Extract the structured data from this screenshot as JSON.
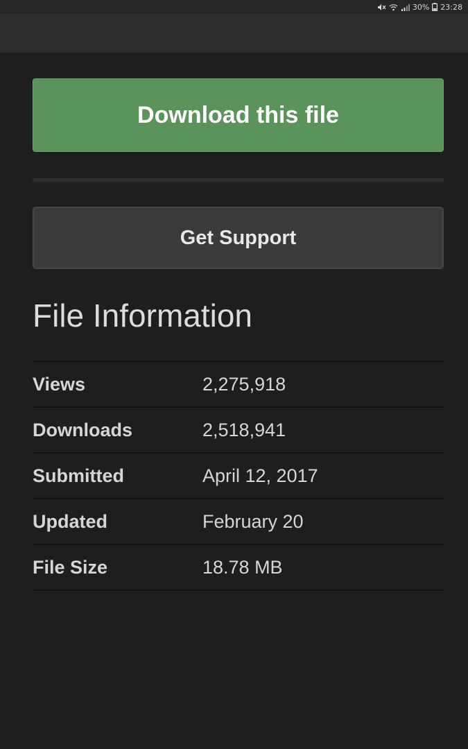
{
  "status_bar": {
    "battery": "30%",
    "time": "23:28"
  },
  "actions": {
    "download_label": "Download this file",
    "support_label": "Get Support"
  },
  "file_information": {
    "title": "File Information",
    "rows": [
      {
        "label": "Views",
        "value": "2,275,918"
      },
      {
        "label": "Downloads",
        "value": "2,518,941"
      },
      {
        "label": "Submitted",
        "value": "April 12, 2017"
      },
      {
        "label": "Updated",
        "value": "February 20"
      },
      {
        "label": "File Size",
        "value": "18.78 MB"
      }
    ]
  },
  "colors": {
    "background": "#1e1e1e",
    "download_button": "#5b935c",
    "support_button": "#3a3a3a"
  },
  "icons": [
    "mute-icon",
    "wifi-icon",
    "signal-icon",
    "battery-icon"
  ]
}
